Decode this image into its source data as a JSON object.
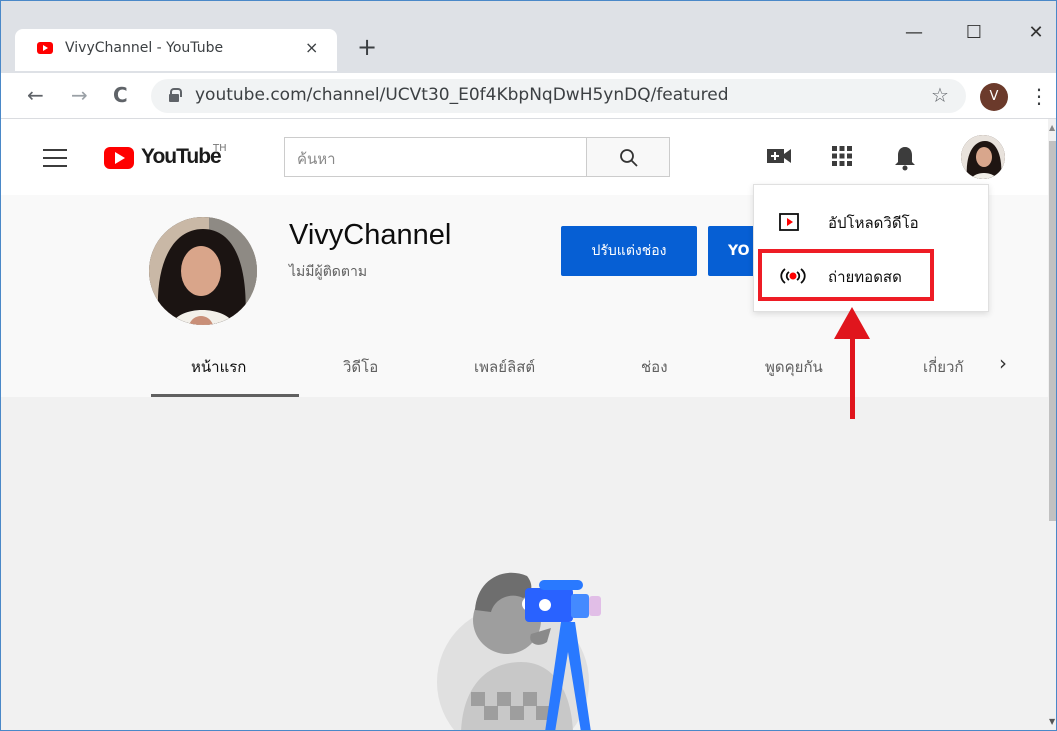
{
  "browser": {
    "tab_title": "VivyChannel - YouTube",
    "tab_close": "×",
    "new_tab": "+",
    "url": "youtube.com/channel/UCVt30_E0f4KbpNqDwH5ynDQ/featured",
    "profile_initial": "V",
    "window_controls": {
      "minimize": "—",
      "maximize": "☐",
      "close": "✕"
    },
    "nav": {
      "back": "←",
      "forward": "→",
      "reload": "C"
    },
    "star": "☆",
    "menu": "⋮"
  },
  "masthead": {
    "logo_text": "YouTube",
    "region": "TH",
    "search_placeholder": "ค้นหา"
  },
  "channel": {
    "name": "VivyChannel",
    "subscribers": "ไม่มีผู้ติดตาม",
    "customize_label": "ปรับแต่งช่อง",
    "studio_label": "YO"
  },
  "tabs": [
    "หน้าแรก",
    "วิดีโอ",
    "เพลย์ลิสต์",
    "ช่อง",
    "พูดคุยกัน",
    "เกี่ยวกั"
  ],
  "tabs_next": "›",
  "create_menu": {
    "items": [
      {
        "label": "อัปโหลดวิดีโอ",
        "icon": "upload-video-icon"
      },
      {
        "label": "ถ่ายทอดสด",
        "icon": "live-broadcast-icon"
      }
    ]
  },
  "colors": {
    "accent": "#065fd4",
    "youtube_red": "#ff0000",
    "annotation_red": "#e0151d"
  }
}
